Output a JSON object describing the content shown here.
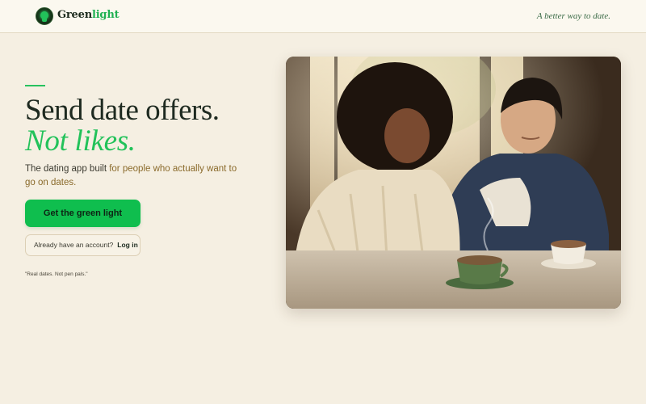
{
  "header": {
    "brand_main": "Green",
    "brand_accent": "light",
    "logo_icon": "lightbulb-icon",
    "tagline": "A better way to date."
  },
  "hero": {
    "headline": "Send date offers.",
    "headline_accent": "Not likes.",
    "subtitle_start": "The dating app built ",
    "subtitle_highlight": "for people who actually want to go on dates.",
    "cta_label": "Get the green light",
    "login_prompt": "Already have an account?",
    "login_link": "Log in",
    "quote": "\"Real dates. Not pen pals.\""
  },
  "colors": {
    "background": "#f5efe2",
    "header_bg": "#fbf8ef",
    "accent_green": "#22c25a",
    "cta_green": "#0fbe4e",
    "text_dark": "#1e2a20",
    "highlight_brown": "#8a6a2b"
  },
  "image": {
    "subject": "couple-in-cafe-photo"
  }
}
